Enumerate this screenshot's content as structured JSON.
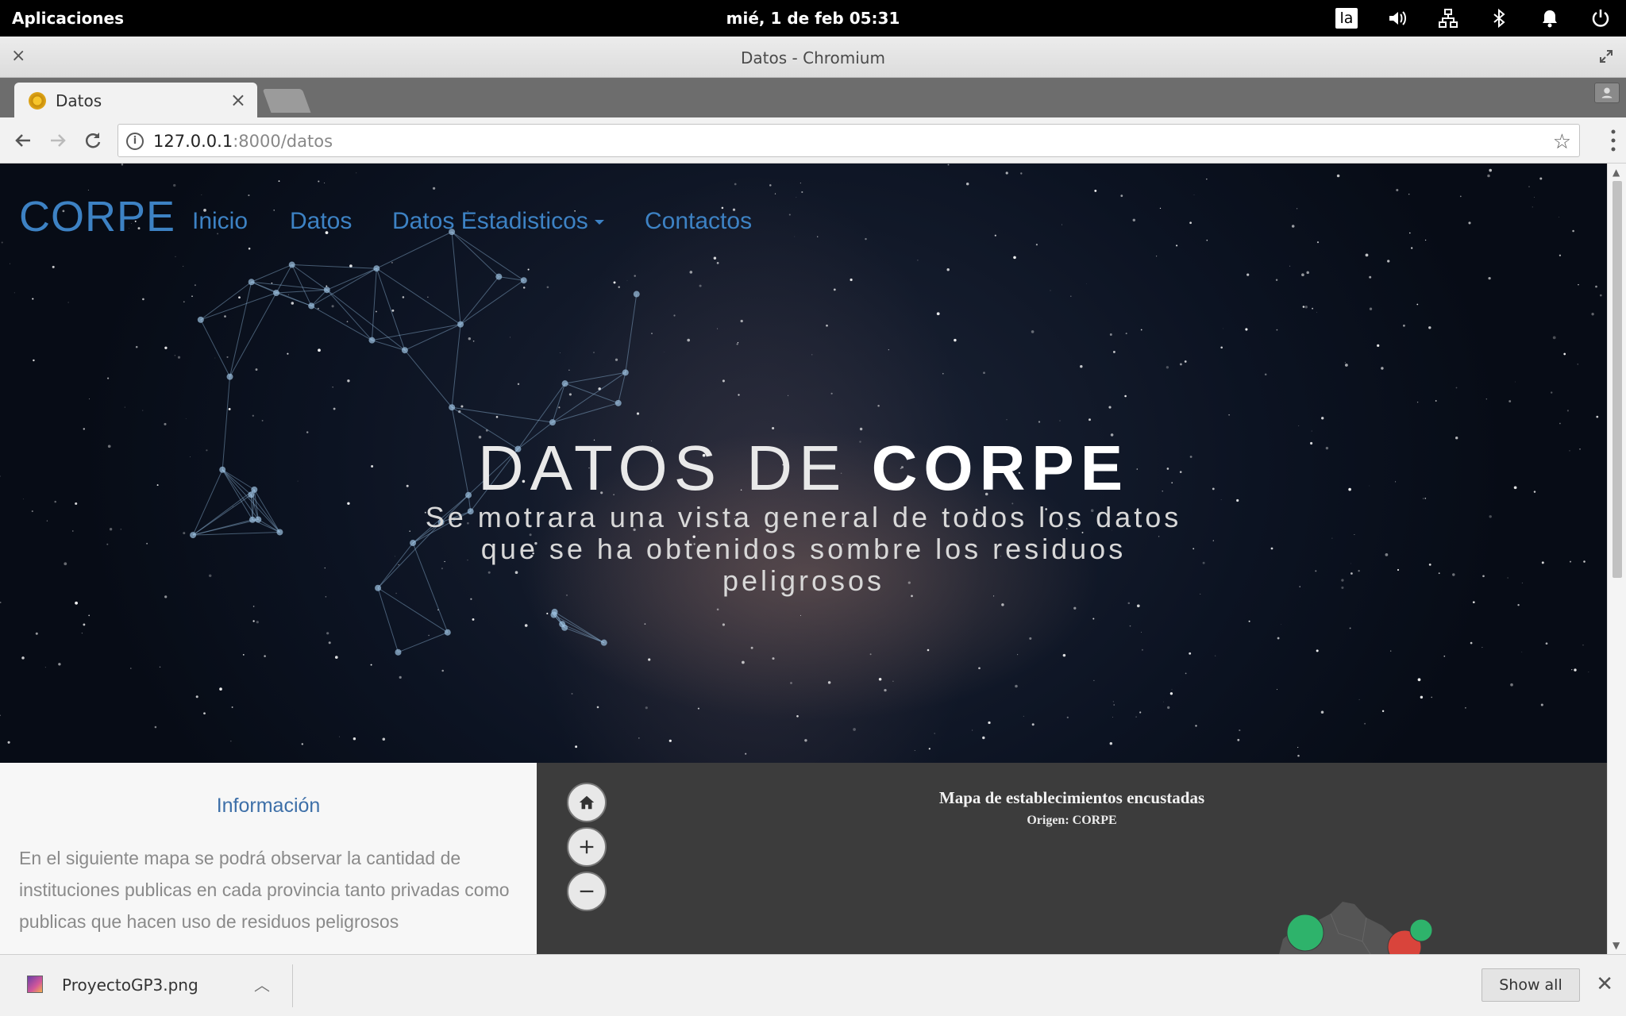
{
  "system_bar": {
    "apps_menu": "Aplicaciones",
    "clock": "mié,  1 de feb    05:31",
    "keyboard_layout": "la",
    "icons": [
      "volume-icon",
      "network-icon",
      "bluetooth-icon",
      "notifications-icon",
      "power-icon"
    ]
  },
  "window": {
    "title": "Datos - Chromium",
    "close_symbol": "×"
  },
  "browser": {
    "tab": {
      "title": "Datos",
      "close_symbol": "×"
    },
    "url_host": "127.0.0.1",
    "url_path": ":8000/datos",
    "star_symbol": "☆"
  },
  "page": {
    "brand": "CORPE",
    "nav": {
      "inicio": "Inicio",
      "datos": "Datos",
      "estadisticos": "Datos Estadisticos",
      "contactos": "Contactos"
    },
    "hero": {
      "title_light": "DATOS DE ",
      "title_bold": "CORPE",
      "subtitle": "Se motrara una vista general de todos los datos que se ha obtenidos sombre los residuos peligrosos"
    },
    "info": {
      "title": "Información",
      "text": "En el siguiente mapa se podrá observar la cantidad de instituciones publicas en cada provincia tanto privadas como publicas que hacen uso de residuos peligrosos"
    },
    "map": {
      "title": "Mapa de establecimientos encustadas",
      "subtitle": "Origen: CORPE",
      "colors": {
        "green": "#2eb36b",
        "red": "#d9443b",
        "land": "#555555"
      }
    }
  },
  "downloads": {
    "file_name": "ProyectoGP3.png",
    "show_all": "Show all",
    "close_symbol": "✕"
  },
  "colors": {
    "accent_link": "#3d82c4",
    "hero_bg": "#0c1322"
  }
}
